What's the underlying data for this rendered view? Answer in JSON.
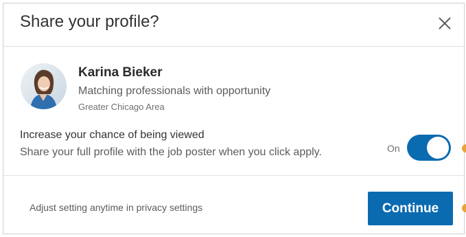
{
  "dialog": {
    "title": "Share your profile?",
    "close_icon": "close-icon"
  },
  "profile": {
    "name": "Karina Bieker",
    "headline": "Matching professionals with opportunity",
    "location": "Greater Chicago Area"
  },
  "visibility": {
    "title": "Increase your chance of being viewed",
    "description": "Share your full profile with the job poster when you click apply.",
    "toggle_label": "On",
    "toggle_on": true
  },
  "footer": {
    "note": "Adjust setting anytime in privacy settings",
    "continue_label": "Continue"
  },
  "colors": {
    "accent": "#0b6bb0",
    "marker": "#e8a33a"
  }
}
